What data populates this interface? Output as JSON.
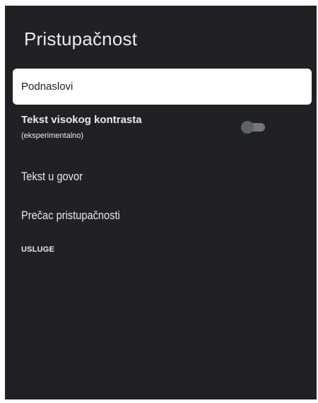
{
  "page": {
    "title": "Pristupačnost"
  },
  "menu": {
    "captions": {
      "label": "Podnaslovi"
    },
    "high_contrast": {
      "label": "Tekst visokog kontrasta",
      "sublabel": "(eksperimentalno)",
      "toggle_on": false
    },
    "text_to_speech": {
      "label": "Tekst u govor"
    },
    "shortcut": {
      "label": "Prečac pristupačnosti"
    }
  },
  "sections": {
    "services_header": "USLUGE"
  },
  "colors": {
    "background": "#202124",
    "text": "#e8eaed",
    "selected_bg": "#ffffff",
    "selected_text": "#202124"
  }
}
